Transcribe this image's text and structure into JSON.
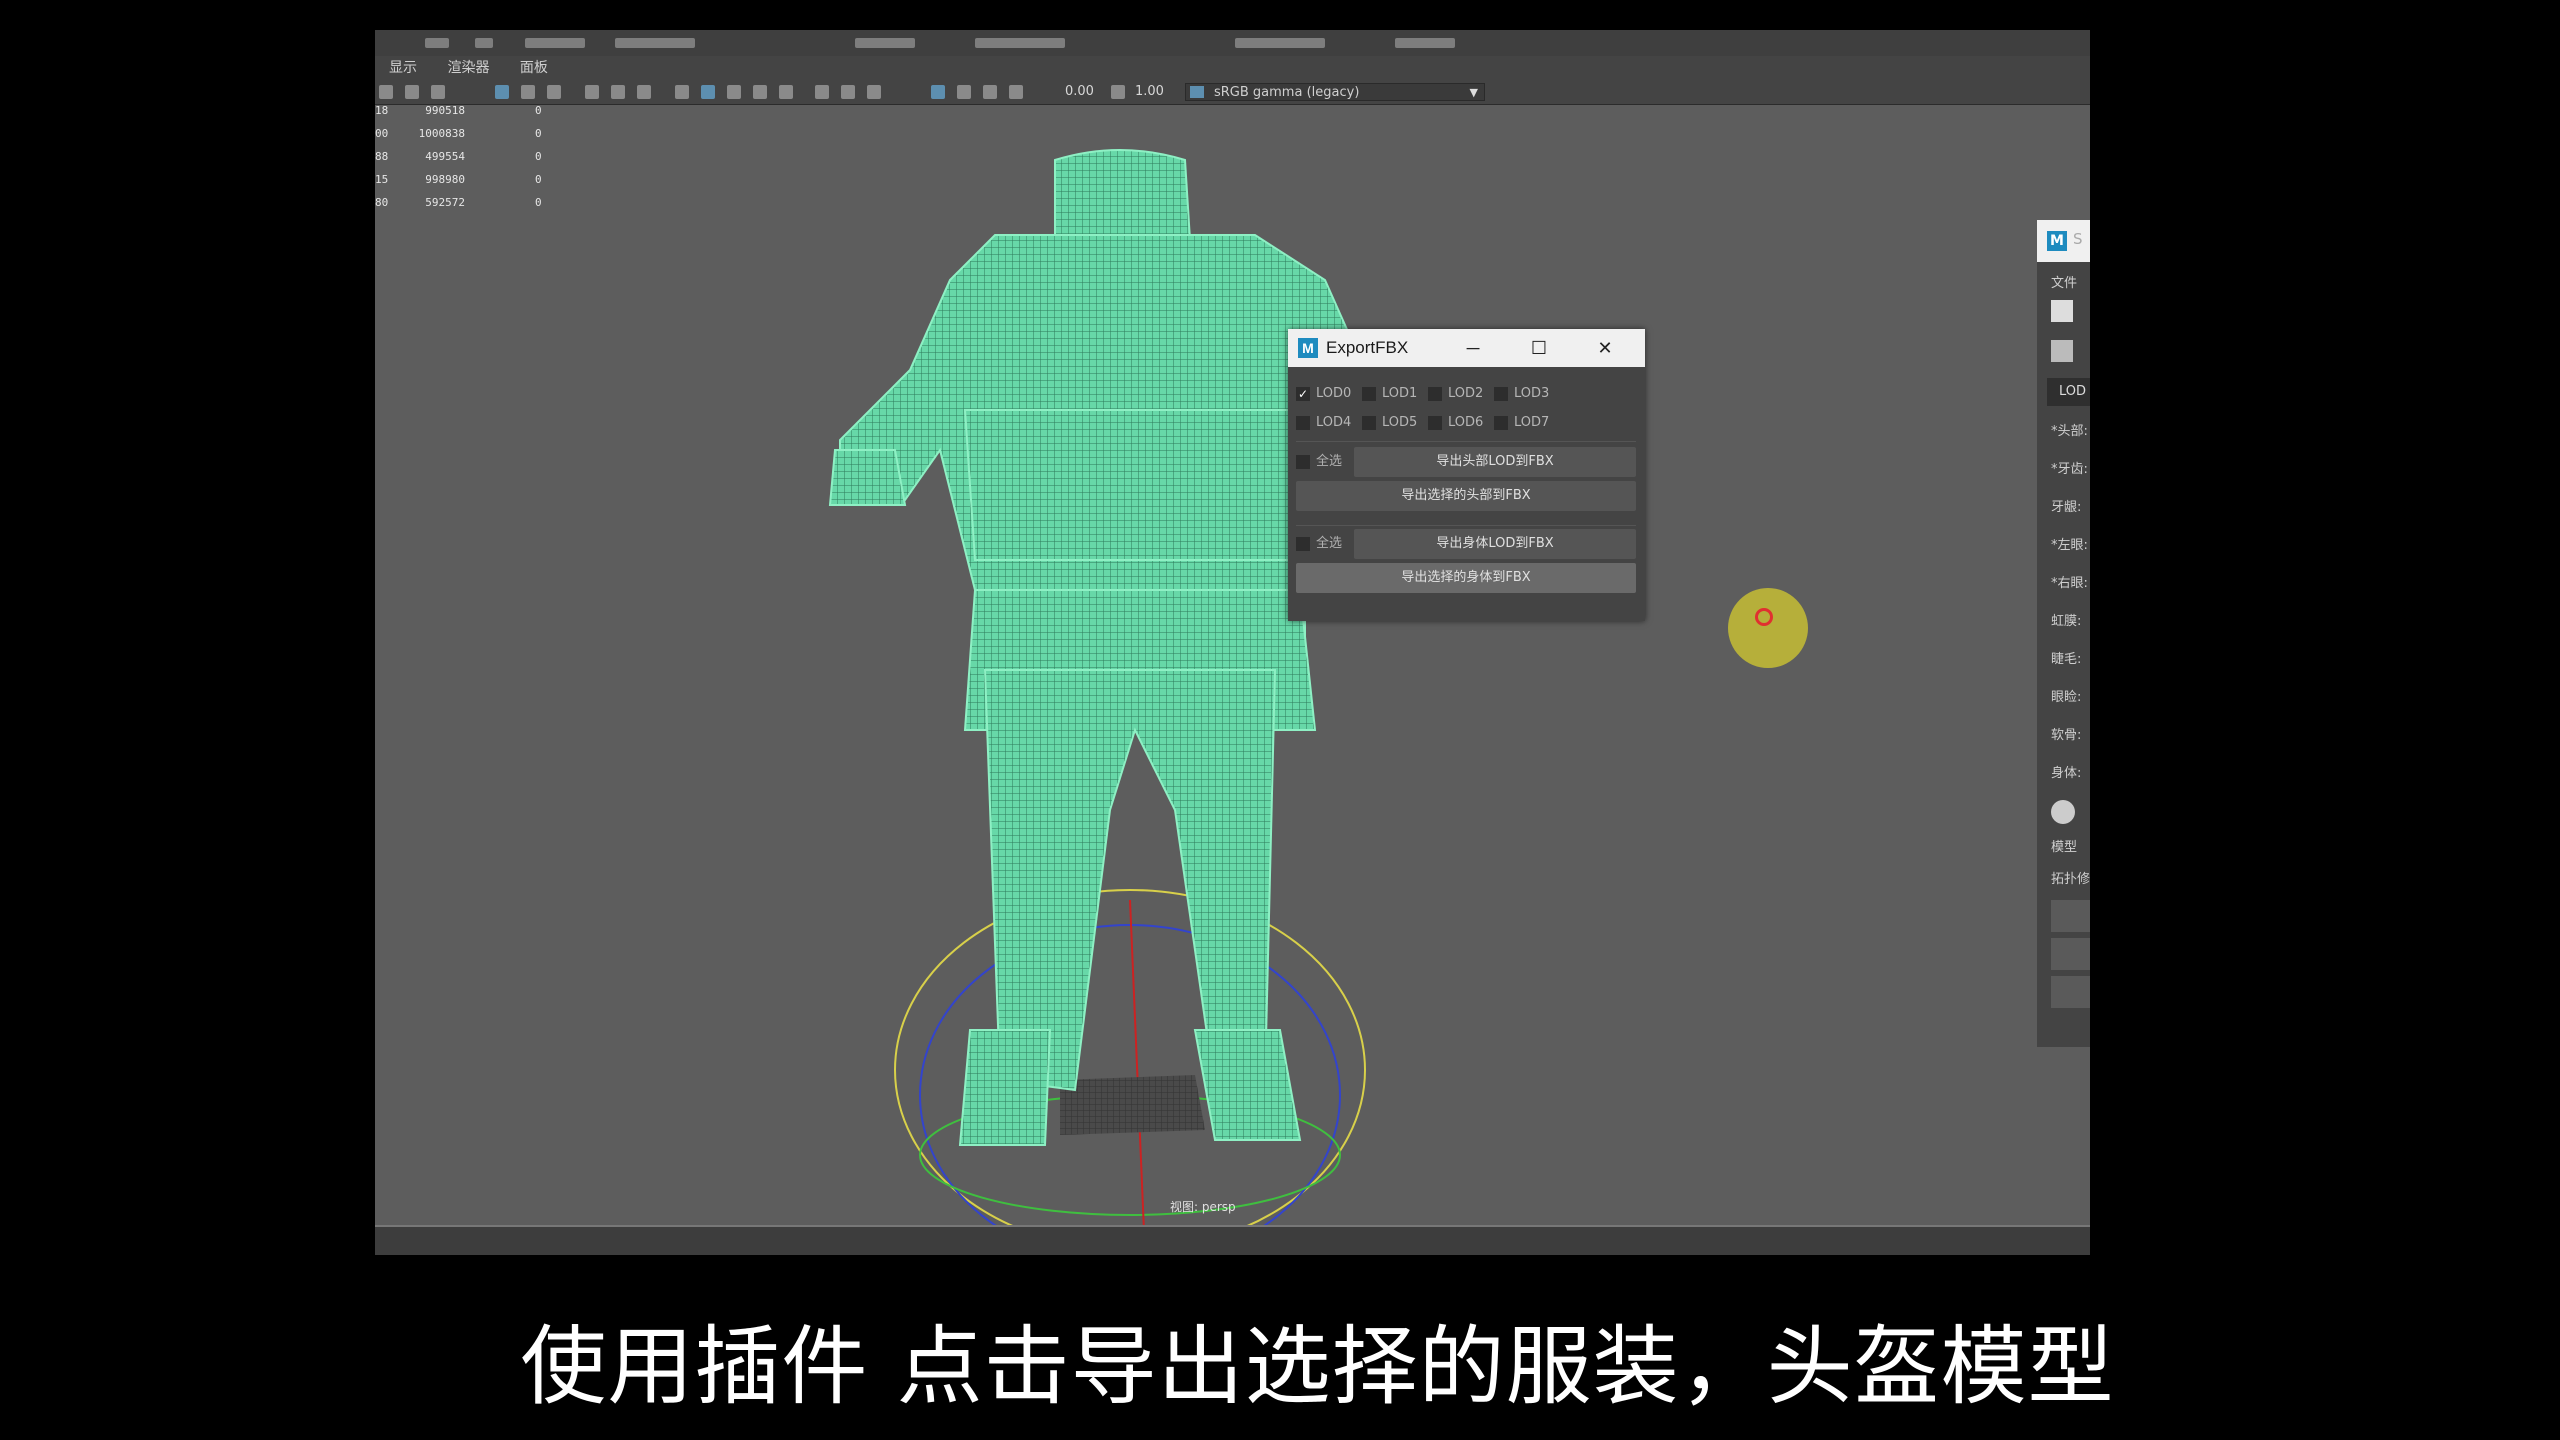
{
  "menu": [
    "显示",
    "渲染器",
    "面板"
  ],
  "toolbar": {
    "exposure": "0.00",
    "gamma": "1.00",
    "color_space": "sRGB gamma (legacy)"
  },
  "hud_stats": [
    {
      "a": "18",
      "b": "990518",
      "c": "0"
    },
    {
      "a": "00",
      "b": "1000838",
      "c": "0"
    },
    {
      "a": "88",
      "b": "499554",
      "c": "0"
    },
    {
      "a": "15",
      "b": "998980",
      "c": "0"
    },
    {
      "a": "80",
      "b": "592572",
      "c": "0"
    }
  ],
  "viewport_label": "视图: persp",
  "dialog": {
    "icon": "M",
    "title": "ExportFBX",
    "lods": [
      {
        "label": "LOD0",
        "checked": true
      },
      {
        "label": "LOD1",
        "checked": false
      },
      {
        "label": "LOD2",
        "checked": false
      },
      {
        "label": "LOD3",
        "checked": false
      },
      {
        "label": "LOD4",
        "checked": false
      },
      {
        "label": "LOD5",
        "checked": false
      },
      {
        "label": "LOD6",
        "checked": false
      },
      {
        "label": "LOD7",
        "checked": false
      }
    ],
    "select_all_1": "全选",
    "export_head_lod": "导出头部LOD到FBX",
    "export_selected_head": "导出选择的头部到FBX",
    "select_all_2": "全选",
    "export_body_lod": "导出身体LOD到FBX",
    "export_selected_body": "导出选择的身体到FBX",
    "check_mark": "✓"
  },
  "right_panel": {
    "icon": "M",
    "title_fragment": "S",
    "menu_file": "文件",
    "lod_label": "LOD",
    "items": [
      "*头部:",
      "*牙齿:",
      "牙龈:",
      "*左眼:",
      "*右眼:",
      "虹膜:",
      "睫毛:",
      "眼睑:",
      "软骨:",
      "身体:"
    ],
    "model_label": "模型",
    "topology_label": "拓扑修"
  },
  "subtitle": "使用插件 点击导出选择的服装，头盔模型"
}
